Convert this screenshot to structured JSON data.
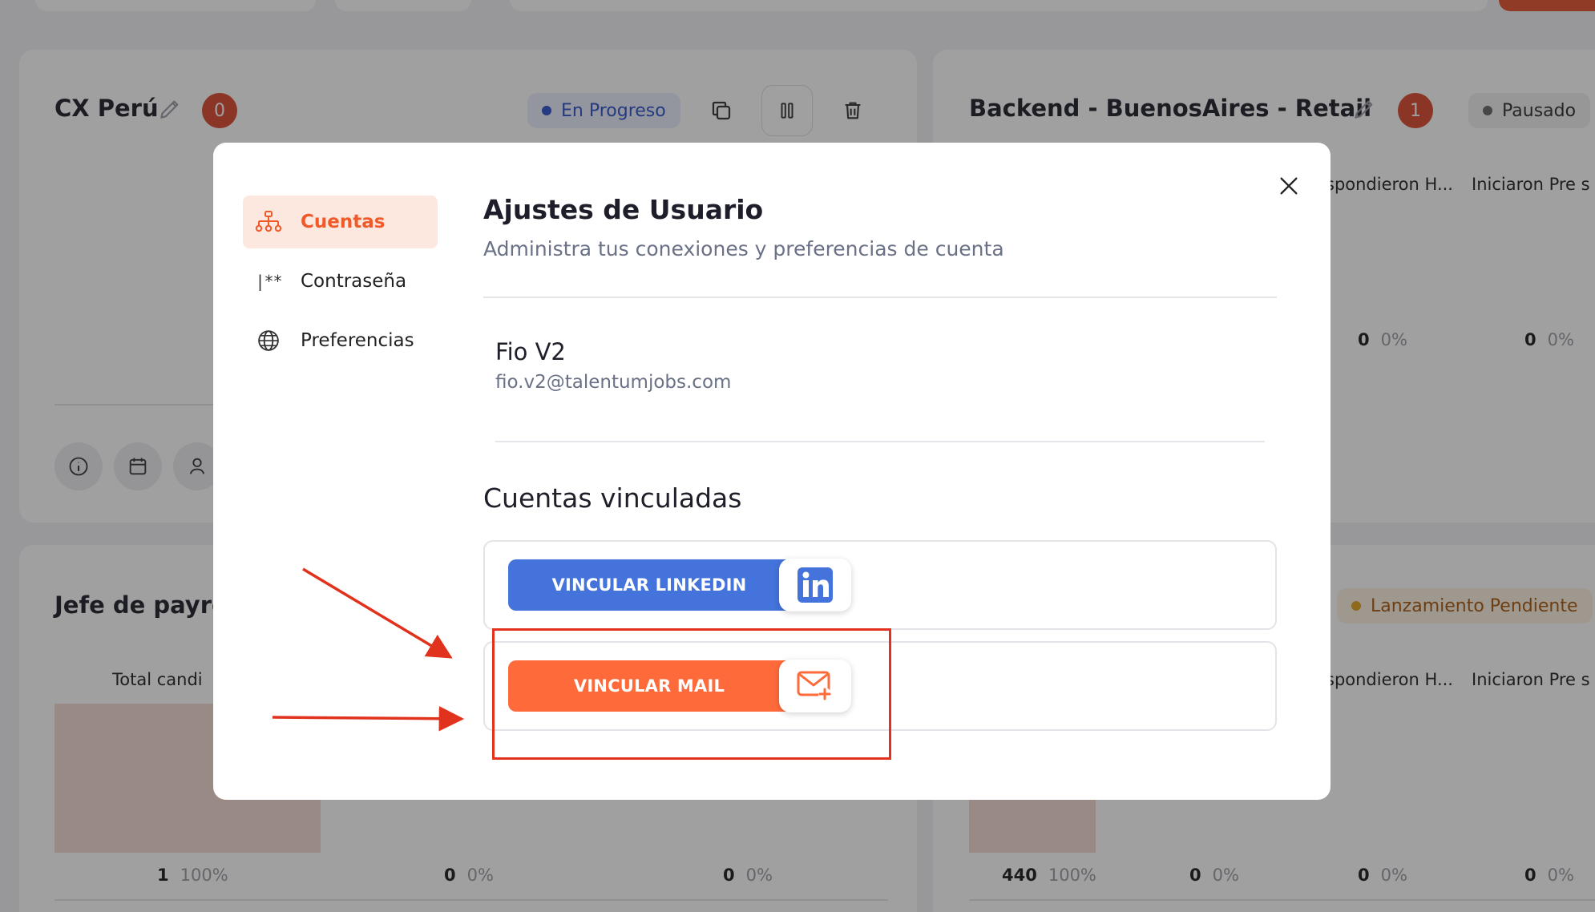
{
  "dashboard": {
    "card1": {
      "title": "CX Perú",
      "count": "0",
      "status": "En Progreso"
    },
    "card2": {
      "title": "Backend - BuenosAires - Retail",
      "count": "1",
      "status": "Pausado",
      "columns": [
        "spondieron H...",
        "Iniciaron Pre s"
      ],
      "stats": [
        {
          "value": "0",
          "pct": "0%"
        },
        {
          "value": "0",
          "pct": "0%"
        }
      ]
    },
    "card3": {
      "title": "Jefe de payro",
      "column": "Total candi",
      "stats": [
        {
          "value": "1",
          "pct": "100%"
        },
        {
          "value": "0",
          "pct": "0%"
        },
        {
          "value": "0",
          "pct": "0%"
        }
      ]
    },
    "card4": {
      "status": "Lanzamiento Pendiente",
      "columns": [
        "spondieron H...",
        "Iniciaron Pre s"
      ],
      "stats": [
        {
          "value": "440",
          "pct": "100%"
        },
        {
          "value": "0",
          "pct": "0%"
        },
        {
          "value": "0",
          "pct": "0%"
        },
        {
          "value": "0",
          "pct": "0%"
        }
      ]
    }
  },
  "modal": {
    "sidebar": {
      "items": [
        {
          "label": "Cuentas",
          "icon": "sitemap-icon",
          "active": true
        },
        {
          "label": "Contraseña",
          "icon": "password-icon",
          "active": false
        },
        {
          "label": "Preferencias",
          "icon": "globe-icon",
          "active": false
        }
      ]
    },
    "title": "Ajustes de Usuario",
    "subtitle": "Administra tus conexiones y preferencias de cuenta",
    "user": {
      "name": "Fio V2",
      "email": "fio.v2@talentumjobs.com"
    },
    "linked_section_title": "Cuentas vinculadas",
    "linkedin_button": "VINCULAR LINKEDIN",
    "mail_button": "VINCULAR MAIL"
  },
  "colors": {
    "accent": "#f05a2a",
    "linkedin": "#4373db",
    "mail": "#ff6a3a",
    "annotation": "#e1321d"
  }
}
